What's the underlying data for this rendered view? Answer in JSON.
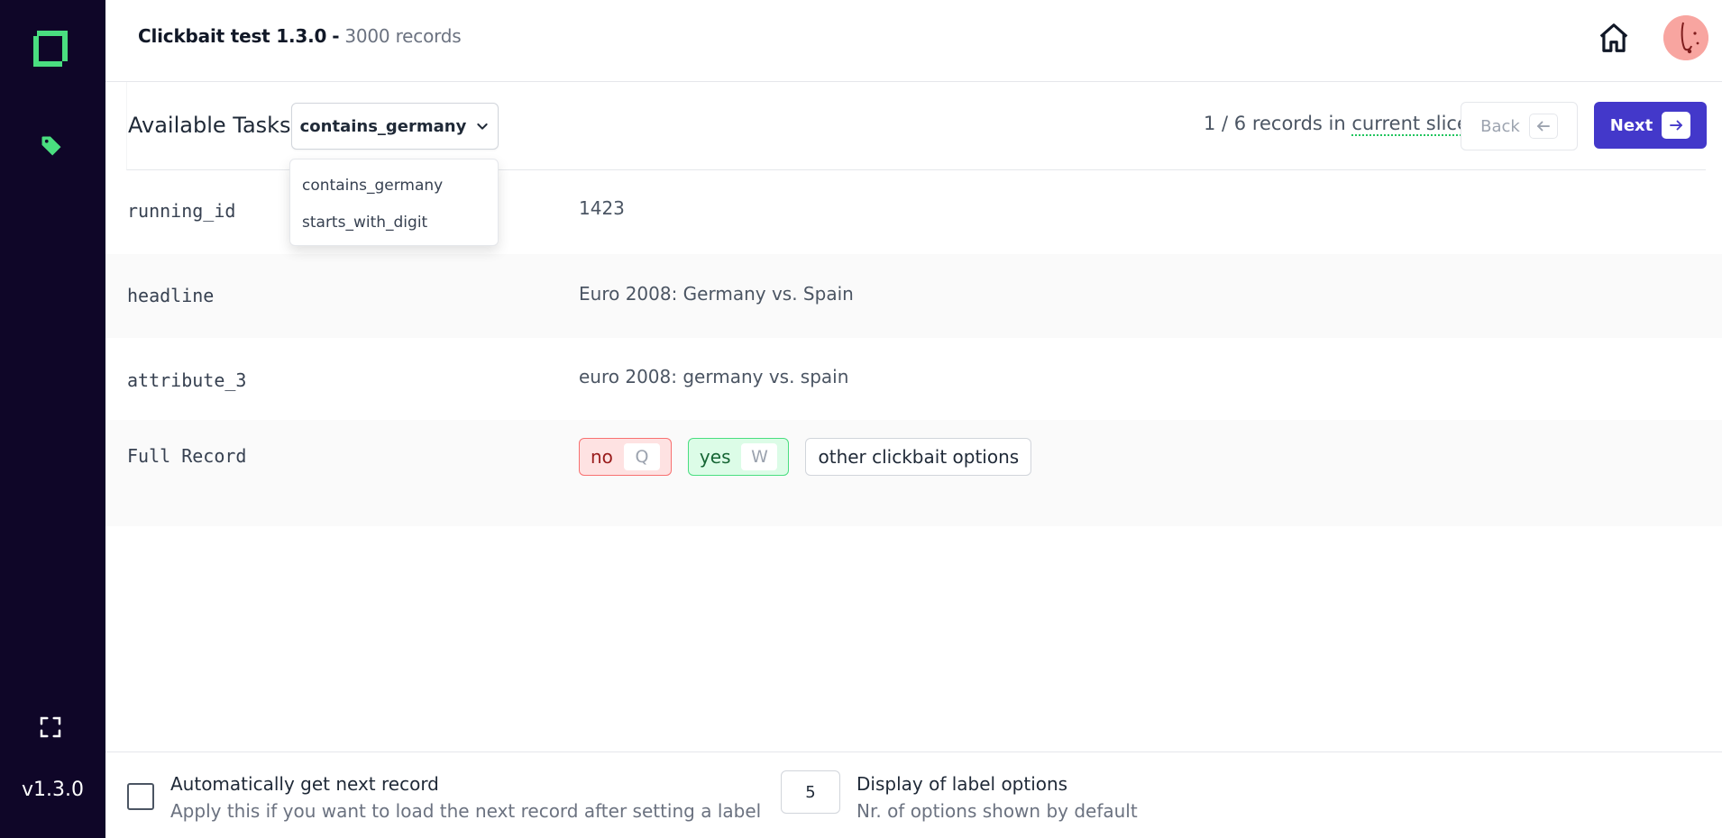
{
  "sidebar": {
    "version": "v1.3.0",
    "icons": {
      "logo": "kern-logo",
      "nav": "tag-icon",
      "fullscreen": "fullscreen-icon"
    }
  },
  "header": {
    "project_name": "Clickbait test 1.3.0",
    "separator": "-",
    "record_count": "3000 records"
  },
  "taskbar": {
    "label": "Available Tasks:",
    "selected_task": "contains_germany",
    "options": [
      "contains_germany",
      "starts_with_digit"
    ],
    "slice_prefix": "1 / 6 records in",
    "slice_link": "current slice",
    "back_label": "Back",
    "next_label": "Next"
  },
  "record": {
    "rows": [
      {
        "key": "running_id",
        "value": "1423"
      },
      {
        "key": "headline",
        "value": "Euro 2008: Germany vs. Spain"
      },
      {
        "key": "attribute_3",
        "value": "euro 2008: germany vs. spain"
      }
    ],
    "full_record": {
      "key": "Full Record",
      "labels": [
        {
          "name": "no",
          "hotkey": "Q"
        },
        {
          "name": "yes",
          "hotkey": "W"
        }
      ],
      "other_label": "other clickbait options"
    }
  },
  "footer": {
    "auto_next": {
      "title": "Automatically get next record",
      "description": "Apply this if you want to load the next record after setting a label"
    },
    "label_options": {
      "value": "5",
      "title": "Display of label options",
      "description": "Nr. of options shown by default"
    }
  },
  "colors": {
    "sidebar_bg": "#0f0628",
    "accent_green": "#4ade80",
    "primary_button": "#4338ca",
    "avatar_bg": "#f8a5a0"
  }
}
